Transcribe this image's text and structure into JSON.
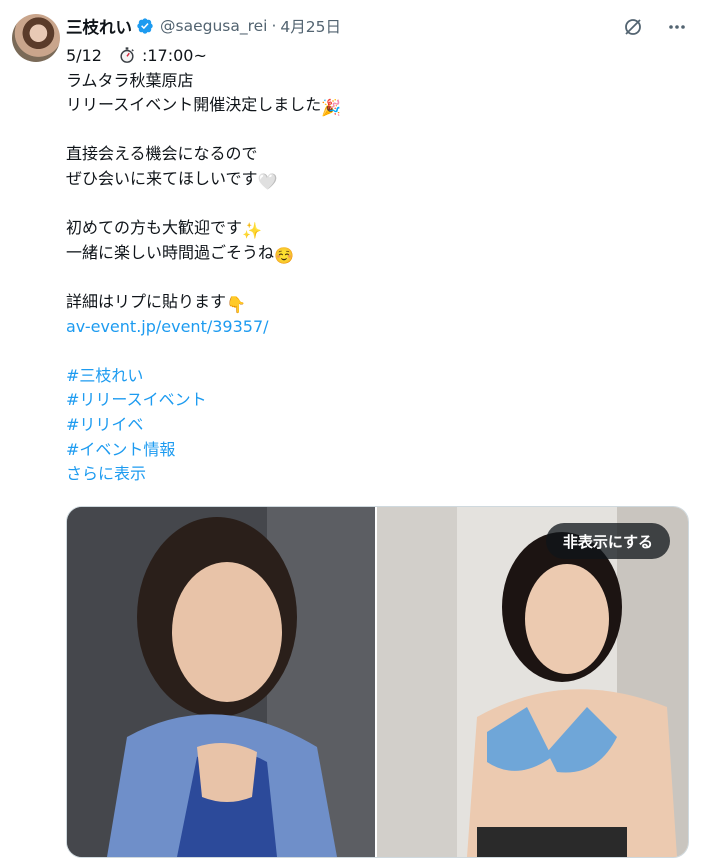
{
  "author": {
    "name": "三枝れい",
    "handle": "@saegusa_rei",
    "separator": "·",
    "date": "4月25日"
  },
  "tweet": {
    "lines": [
      {
        "pre": "5/12",
        "icon": "stopwatch-icon",
        "post": ":17:00~"
      },
      {
        "text": "ラムタラ秋葉原店"
      },
      {
        "text": "リリースイベント開催決定しました",
        "emoji": "🎉"
      },
      {
        "text": ""
      },
      {
        "text": "直接会える機会になるので"
      },
      {
        "text": "ぜひ会いに来てほしいです",
        "emoji": "🤍"
      },
      {
        "text": ""
      },
      {
        "text": "初めての方も大歓迎です",
        "emoji": "✨"
      },
      {
        "text": "一緒に楽しい時間過ごそうね",
        "emoji": "☺️"
      },
      {
        "text": ""
      },
      {
        "text": "詳細はリプに貼ります",
        "emoji": "👇"
      }
    ],
    "link": "av-event.jp/event/39357/",
    "hashtags": [
      "#三枝れい",
      "#リリースイベント",
      "#リリイベ",
      "#イベント情報"
    ],
    "show_more": "さらに表示"
  },
  "media": {
    "hide_button": "非表示にする"
  },
  "icons": {
    "grok": "grok-icon",
    "more": "more-icon",
    "verified": "verified-badge-icon"
  },
  "colors": {
    "link": "#1d9bf0",
    "text": "#0f1419",
    "secondary": "#536471"
  }
}
